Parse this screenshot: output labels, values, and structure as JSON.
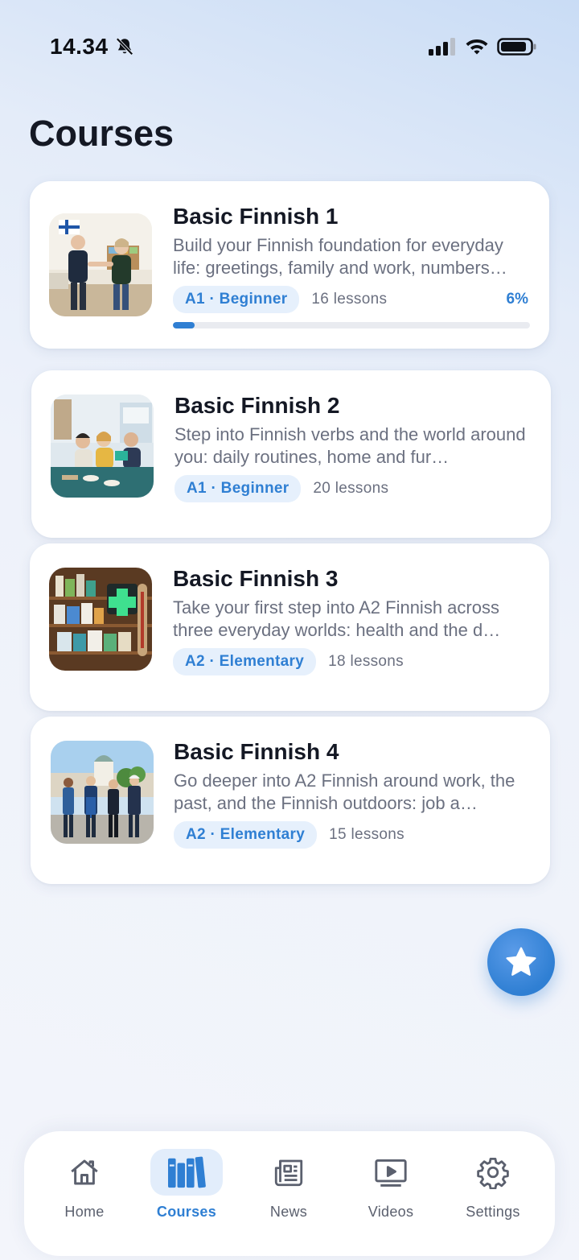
{
  "status_bar": {
    "time": "14.34"
  },
  "page": {
    "title": "Courses"
  },
  "courses": [
    {
      "title": "Basic Finnish 1",
      "description": "Build your Finnish foundation for everyday life: greetings, family and work, numbers…",
      "level": "A1 · Beginner",
      "lessons": "16 lessons",
      "progress_label": "6%",
      "progress": 0.06
    },
    {
      "title": "Basic Finnish 2",
      "description": "Step into Finnish verbs and the world around you: daily routines, home and fur…",
      "level": "A1 · Beginner",
      "lessons": "20 lessons"
    },
    {
      "title": "Basic Finnish 3",
      "description": "Take your first step into A2 Finnish across three everyday worlds: health and the d…",
      "level": "A2 · Elementary",
      "lessons": "18 lessons"
    },
    {
      "title": "Basic Finnish 4",
      "description": "Go deeper into A2 Finnish around work, the past, and the Finnish outdoors: job a…",
      "level": "A2 · Elementary",
      "lessons": "15 lessons"
    }
  ],
  "fab": {
    "icon": "star-icon"
  },
  "tab_bar": {
    "items": [
      {
        "label": "Home",
        "icon": "home-icon",
        "active": false
      },
      {
        "label": "Courses",
        "icon": "books-icon",
        "active": true
      },
      {
        "label": "News",
        "icon": "newspaper-icon",
        "active": false
      },
      {
        "label": "Videos",
        "icon": "play-icon",
        "active": false
      },
      {
        "label": "Settings",
        "icon": "gear-icon",
        "active": false
      }
    ]
  },
  "colors": {
    "accent": "#2f7fd3",
    "badge_bg": "#e6f0fc",
    "text_primary": "#141824",
    "text_secondary": "#6b7080"
  }
}
